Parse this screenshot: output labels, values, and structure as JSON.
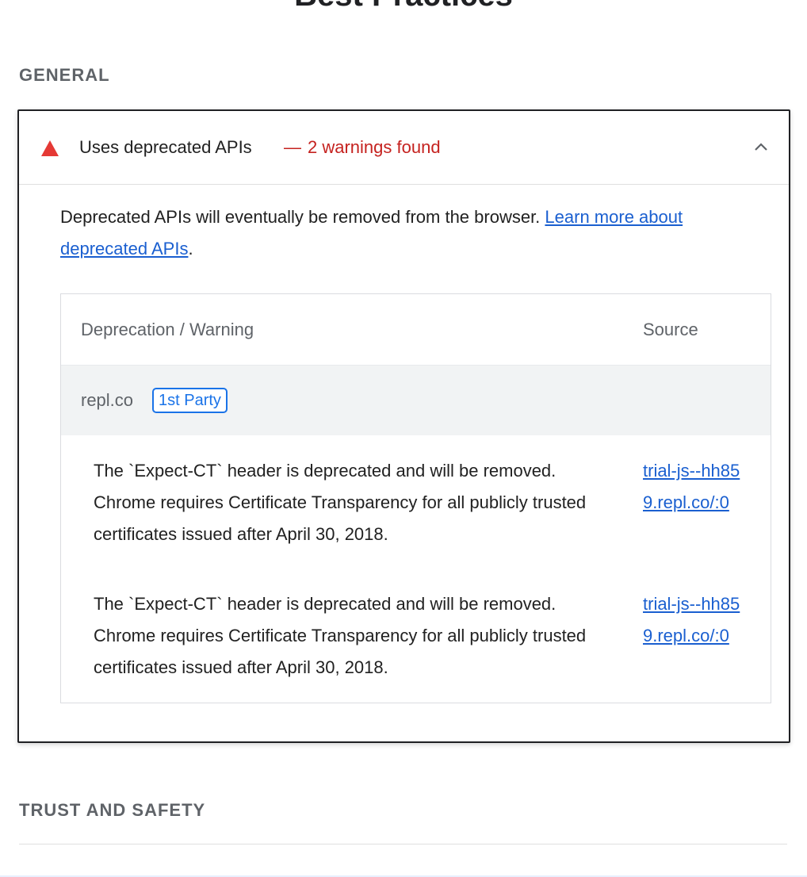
{
  "page": {
    "title": "Best Practices"
  },
  "groups": [
    {
      "heading": "GENERAL"
    },
    {
      "heading": "TRUST AND SAFETY"
    }
  ],
  "audit": {
    "title": "Uses deprecated APIs",
    "separator": "—",
    "display_value": "2 warnings found",
    "status_icon": "warning-triangle-icon",
    "status_color": "#e53935",
    "expanded": true,
    "description": "Deprecated APIs will eventually be removed from the browser.",
    "learn_more_link": "Learn more about deprecated APIs",
    "description_end": "."
  },
  "table": {
    "headers": {
      "deprecation": "Deprecation / Warning",
      "source": "Source"
    },
    "entity": {
      "name": "repl.co",
      "badge": "1st Party"
    },
    "rows": [
      {
        "warning": "The `Expect-CT` header is deprecated and will be removed. Chrome requires Certificate Transparency for all publicly trusted certificates issued after April 30, 2018.",
        "source": "trial-js--hh859.repl.co/:0"
      },
      {
        "warning": "The `Expect-CT` header is deprecated and will be removed. Chrome requires Certificate Transparency for all publicly trusted certificates issued after April 30, 2018.",
        "source": "trial-js--hh859.repl.co/:0"
      }
    ]
  },
  "colors": {
    "link": "#1a5fd0",
    "fail": "#c5221f",
    "badge": "#1a73e8"
  }
}
